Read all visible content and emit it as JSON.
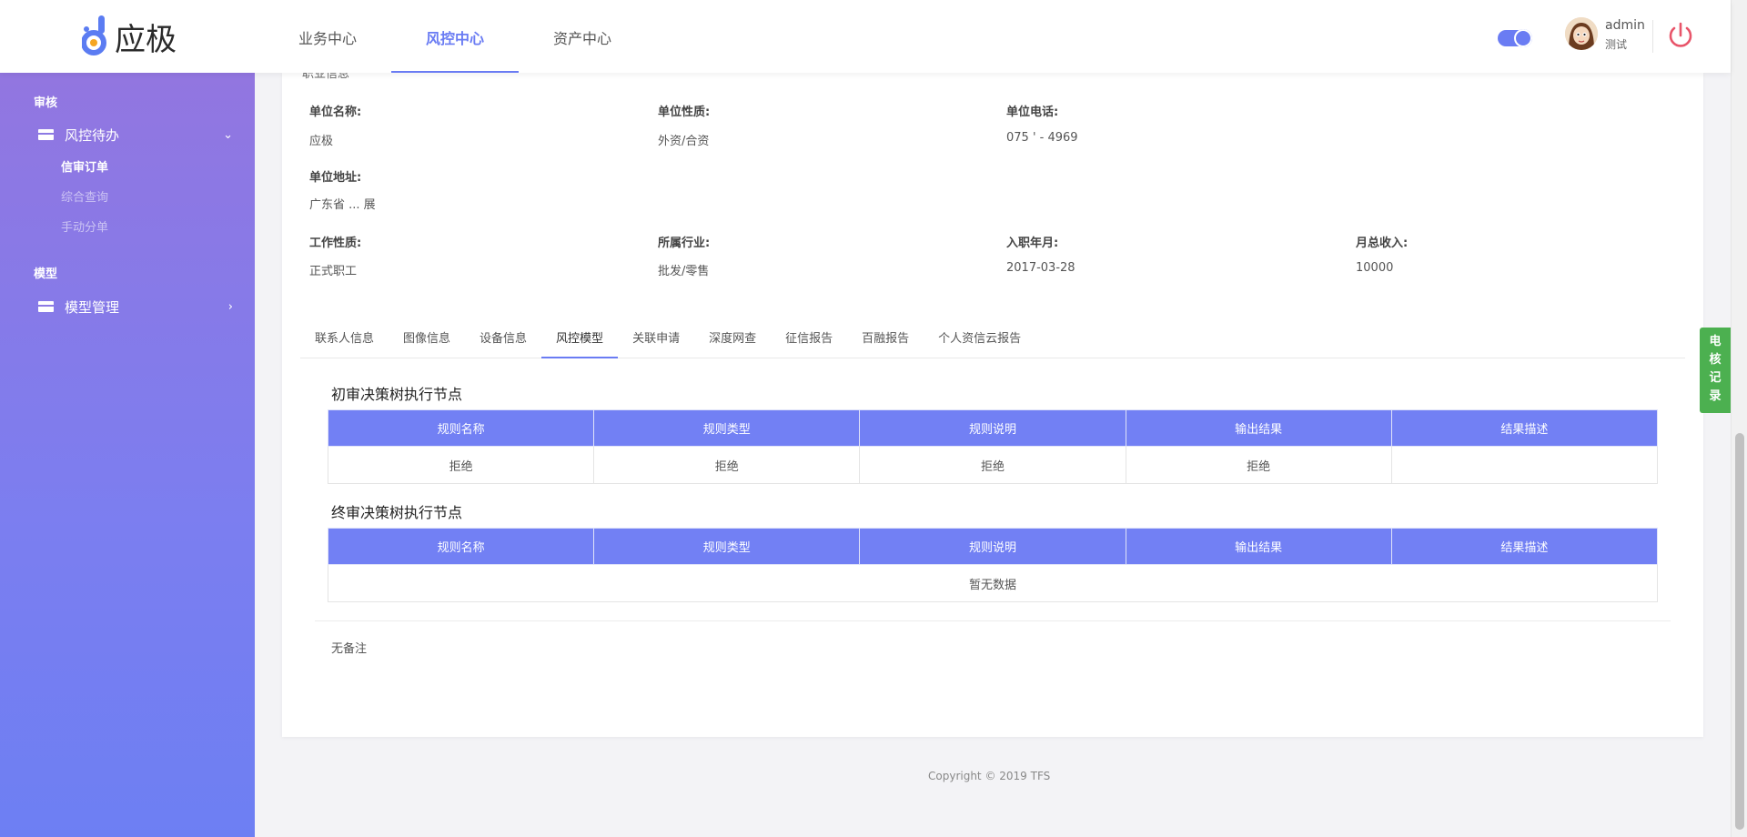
{
  "header": {
    "logo_text": "应极",
    "nav": [
      "业务中心",
      "风控中心",
      "资产中心"
    ],
    "user_name": "admin",
    "user_role": "测试"
  },
  "sidebar": {
    "section1": "审核",
    "menu1": "风控待办",
    "menu1_arrow": "⌄",
    "sub_items": [
      "信审订单",
      "综合查询",
      "手动分单"
    ],
    "section2": "模型",
    "menu2": "模型管理",
    "menu2_arrow": "›"
  },
  "info": {
    "cut_title": "职业信息",
    "unit_name_label": "单位名称:",
    "unit_name": "应极",
    "unit_type_label": "单位性质:",
    "unit_type": "外资/合资",
    "unit_phone_label": "单位电话:",
    "unit_phone": "075 ' - 4969",
    "unit_addr_label": "单位地址:",
    "unit_addr": "广东省 ... 展",
    "job_type_label": "工作性质:",
    "job_type": "正式职工",
    "industry_label": "所属行业:",
    "industry": "批发/零售",
    "entry_label": "入职年月:",
    "entry": "2017-03-28",
    "income_label": "月总收入:",
    "income": "10000"
  },
  "tabs": [
    "联系人信息",
    "图像信息",
    "设备信息",
    "风控模型",
    "关联申请",
    "深度网查",
    "征信报告",
    "百融报告",
    "个人资信云报告"
  ],
  "table1": {
    "title": "初审决策树执行节点",
    "headers": [
      "规则名称",
      "规则类型",
      "规则说明",
      "输出结果",
      "结果描述"
    ],
    "rows": [
      [
        "拒绝",
        "拒绝",
        "拒绝",
        "拒绝",
        ""
      ]
    ]
  },
  "table2": {
    "title": "终审决策树执行节点",
    "headers": [
      "规则名称",
      "规则类型",
      "规则说明",
      "输出结果",
      "结果描述"
    ],
    "empty": "暂无数据"
  },
  "remark": "无备注",
  "footer": "Copyright © 2019 TFS",
  "float_tab": [
    "电",
    "核",
    "记",
    "录"
  ],
  "colors": {
    "accent": "#6a7cf3",
    "table_header": "#7280f4",
    "float_tab": "#4cb050",
    "power_icon": "#e8556a"
  }
}
